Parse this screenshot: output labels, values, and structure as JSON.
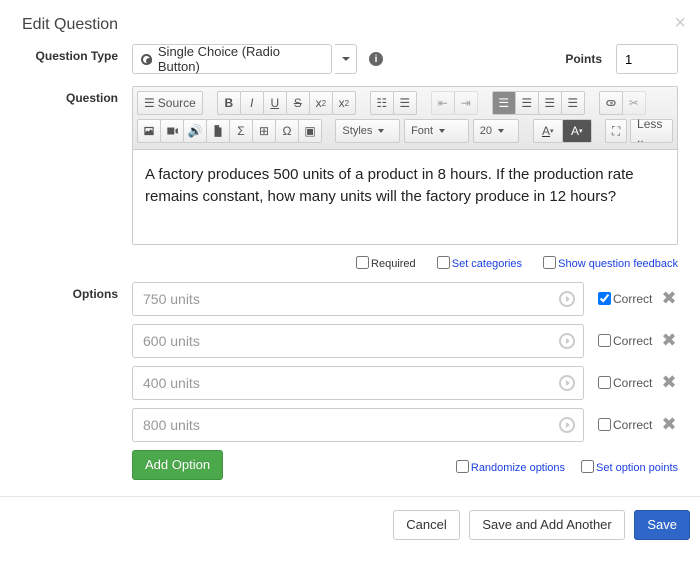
{
  "header": {
    "title": "Edit Question"
  },
  "labels": {
    "question_type": "Question Type",
    "question": "Question",
    "options": "Options",
    "points": "Points",
    "required": "Required",
    "set_categories": "Set categories",
    "show_feedback": "Show question feedback",
    "correct": "Correct",
    "randomize": "Randomize options",
    "set_option_points": "Set option points",
    "add_option": "Add Option"
  },
  "question_type": {
    "selected": "Single Choice (Radio Button)"
  },
  "points_value": "1",
  "toolbar": {
    "source": "Source",
    "styles": "Styles",
    "font": "Font",
    "size": "20",
    "less": "Less .."
  },
  "question_text": "A factory produces 500 units of a product in 8 hours. If the production rate remains constant, how many units will the factory produce in 12 hours?",
  "options": [
    {
      "text": "750 units",
      "correct": true
    },
    {
      "text": "600 units",
      "correct": false
    },
    {
      "text": "400 units",
      "correct": false
    },
    {
      "text": "800 units",
      "correct": false
    }
  ],
  "footer": {
    "cancel": "Cancel",
    "save_another": "Save and Add Another",
    "save": "Save"
  }
}
